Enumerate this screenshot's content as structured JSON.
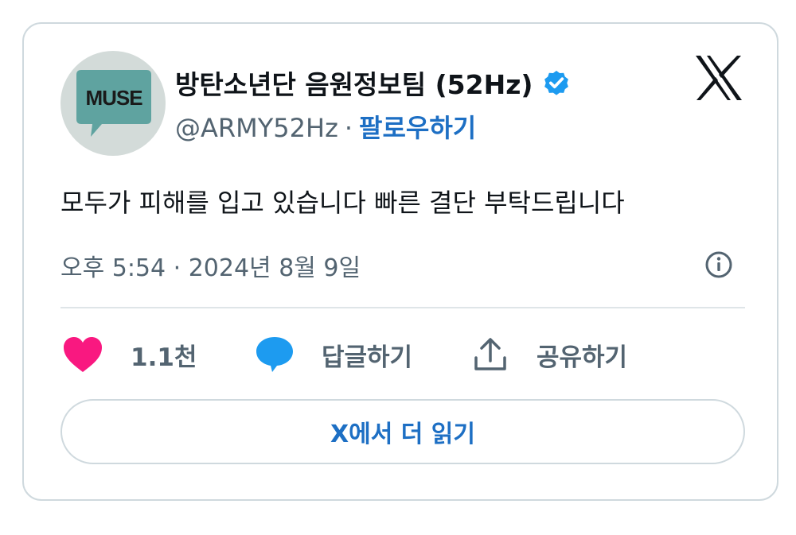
{
  "author": {
    "display_name": "방탄소년단 음원정보팀 (52Hz)",
    "handle": "@ARMY52Hz",
    "separator": "·",
    "follow_label": "팔로우하기",
    "avatar_text": "MUSE"
  },
  "tweet": {
    "text": "모두가 피해를 입고 있습니다 빠른 결단 부탁드립니다",
    "timestamp": "오후 5:54 · 2024년 8월 9일"
  },
  "actions": {
    "like_count": "1.1천",
    "reply_label": "답글하기",
    "share_label": "공유하기"
  },
  "read_more_label": "X에서 더 읽기",
  "icons": {
    "brand": "x-logo-icon",
    "verified": "verified-badge-icon",
    "info": "info-icon",
    "like": "heart-icon",
    "reply": "speech-bubble-icon",
    "share": "share-upload-icon"
  },
  "colors": {
    "accent": "#1d6fc4",
    "verified": "#1d9bf0",
    "heart": "#f91880",
    "reply": "#1d9bf0",
    "muted_text": "#536471",
    "border": "#cfd9de"
  }
}
